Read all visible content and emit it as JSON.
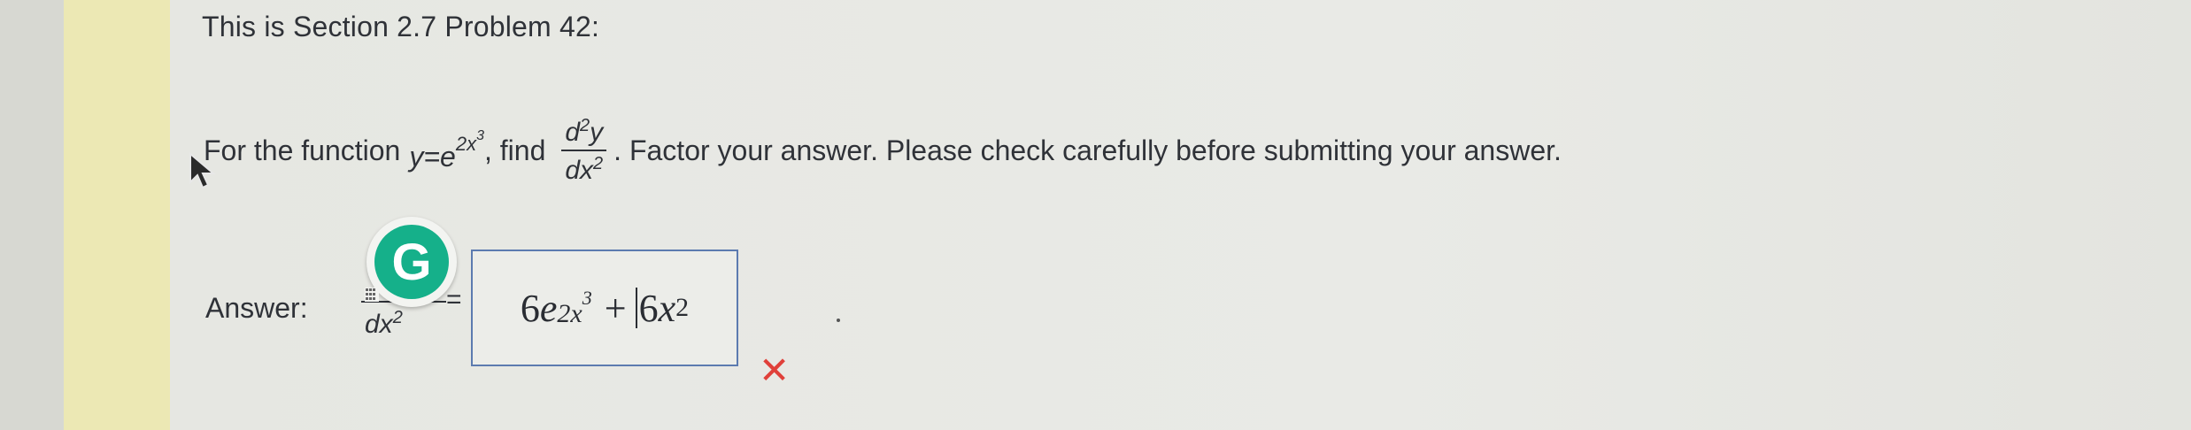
{
  "section_title": "This is Section 2.7 Problem 42:",
  "problem": {
    "prefix": "For the function",
    "y_eq": "y=e",
    "exp_base": "2x",
    "exp_power": "3",
    "find": ", find",
    "frac_num": "d",
    "frac_num_sup": "2",
    "frac_num_var": "y",
    "frac_den": "dx",
    "frac_den_sup": "2",
    "suffix": ". Factor your answer. Please check carefully before submitting your answer."
  },
  "answer": {
    "label": "Answer:",
    "frac_den": "dx",
    "frac_den_sup": "2",
    "equals": "=",
    "term1_coef": "6",
    "term1_base": "e",
    "term1_exp": "2x",
    "term1_exp_pow": "3",
    "plus": "+",
    "term2_coef": "6",
    "term2_var": "x",
    "term2_pow": "2"
  },
  "grammarly_letter": "G",
  "wrong_mark": "✕",
  "colors": {
    "grammarly_green": "#15b08a",
    "wrong_red": "#e0403a",
    "input_border": "#5c7bb0",
    "sidebar_yellow": "#ece8b4"
  }
}
